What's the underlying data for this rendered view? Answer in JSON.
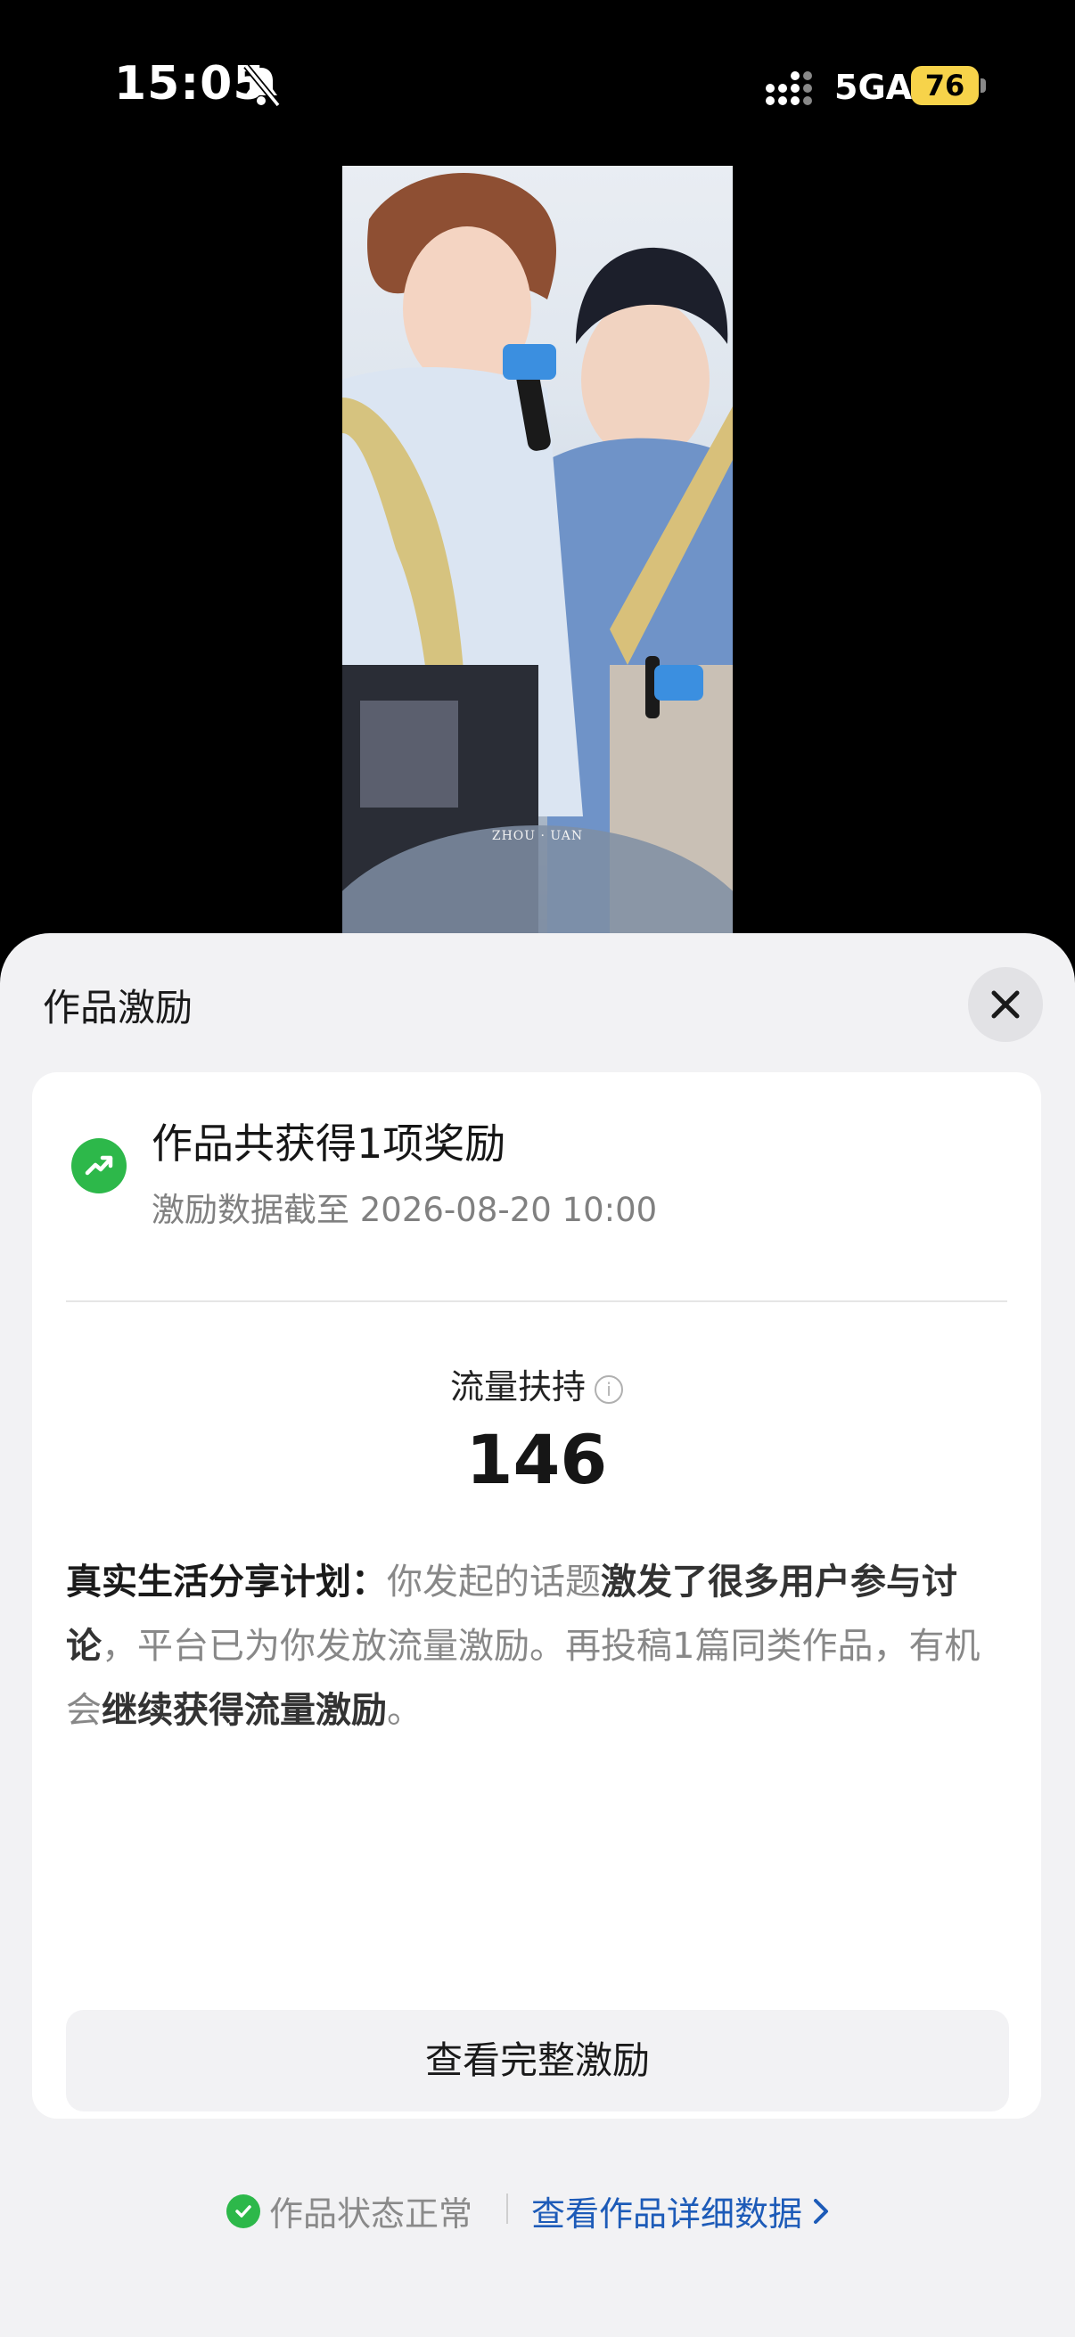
{
  "status_bar": {
    "time": "15:05",
    "network": "5GA",
    "battery": "76"
  },
  "video": {
    "watermark": "ZHOU   ·   UAN"
  },
  "sheet": {
    "title": "作品激励",
    "summary": {
      "title": "作品共获得1项奖励",
      "subtitle": "激励数据截至 2026-08-20 10:00"
    },
    "metric": {
      "label": "流量扶持",
      "value": "146"
    },
    "description": {
      "lead": "真实生活分享计划：",
      "part1": "你发起的话题",
      "bold1": "激发了很多用户参与讨论",
      "part2": "，平台已为你发放流量激励。再投稿1篇同类作品，有机会",
      "bold2": "继续获得流量激励",
      "part3": "。"
    },
    "button_label": "查看完整激励"
  },
  "footer": {
    "status_text": "作品状态正常",
    "link_text": "查看作品详细数据"
  },
  "colors": {
    "accent_green": "#2db84a",
    "link_blue": "#1d5bb8",
    "battery_yellow": "#f7d34a"
  }
}
